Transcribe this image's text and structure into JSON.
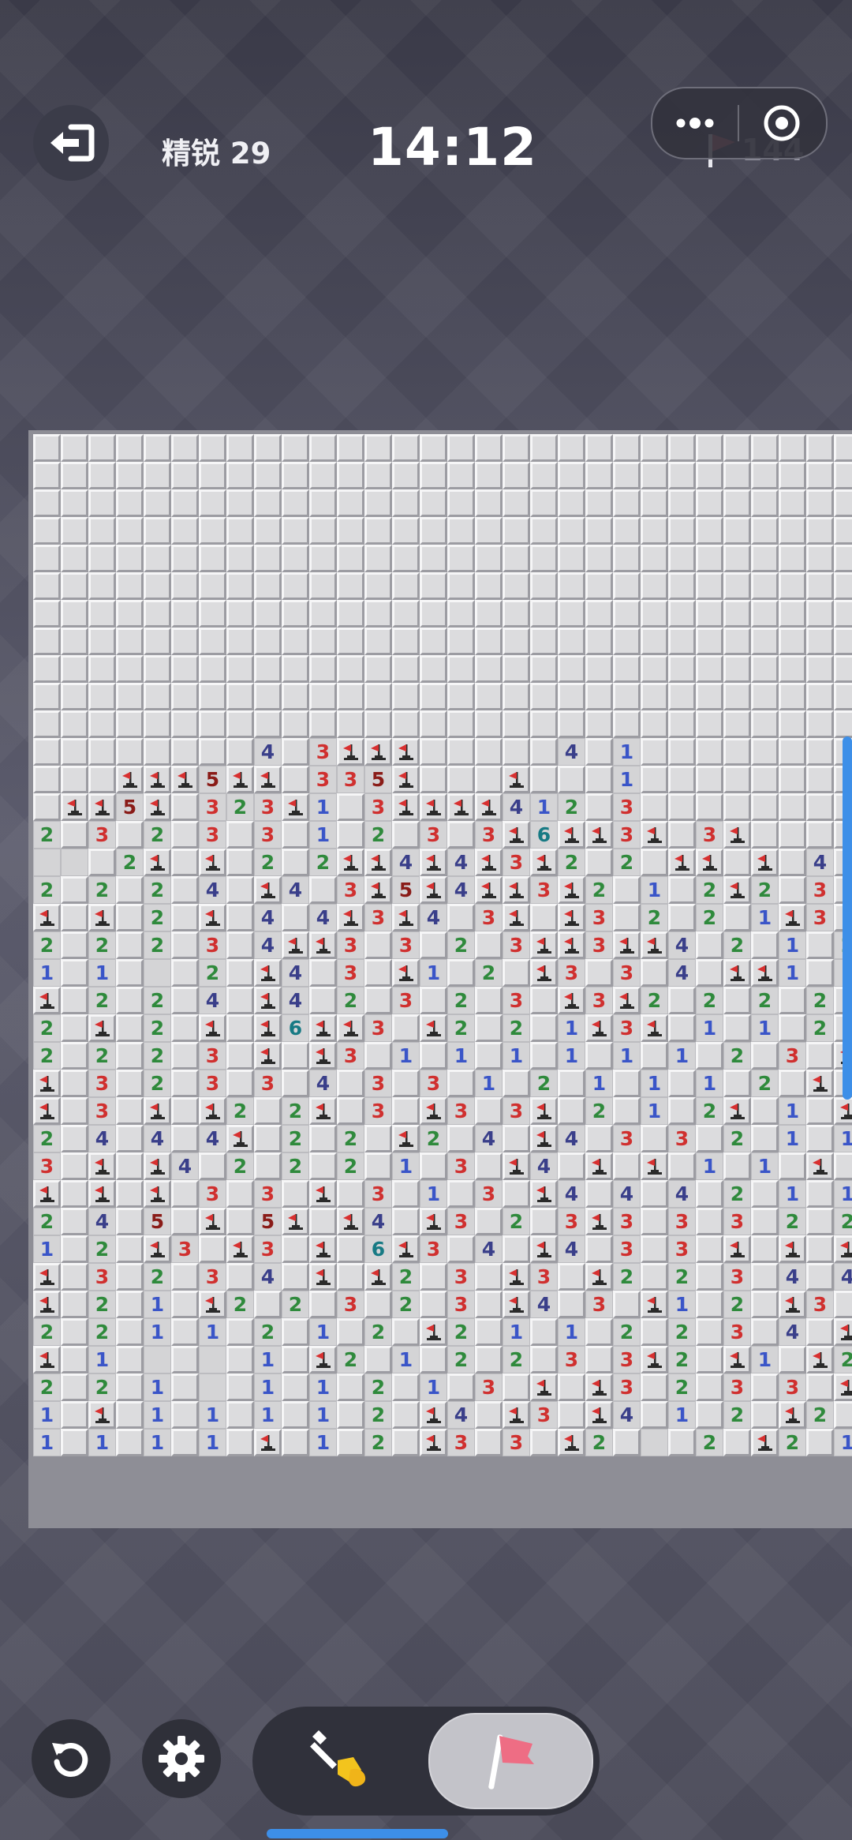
{
  "header": {
    "exit_icon": "exit-icon",
    "level_label": "精锐 29",
    "timer": "14:12",
    "flags_remaining": "144",
    "menu_icon": "more-dots-icon",
    "target_icon": "target-icon"
  },
  "colors": {
    "number_1": "#3a55c8",
    "number_2": "#2f8a3c",
    "number_3": "#d0302f",
    "number_4": "#3a3f8a",
    "number_5": "#8a1c18",
    "number_6": "#177a84",
    "flag": "#d83030",
    "accent_blue": "#3d8fe8"
  },
  "board": {
    "legend": "# hidden, . opened-empty, F flag, 1-6 numbers",
    "rows": [
      "##############################",
      "##############################",
      "##############################",
      "##############################",
      "##############################",
      "##############################",
      "##############################",
      "##############################",
      "##############################",
      "##############################",
      "##############################",
      "########4#3FFF#####4#1########",
      "###FFF5FF#335F###F###1########",
      "#FF5F#323F1#3FFFF412#3########",
      "2#3#2#3#3#1#2#3#3F6FF3F#3F####",
      "..#2F#F#2#2FF4F4F3F2#2#FF#F#4#",
      "2#2#2#4#F4#3F5F4FF3F2#1#2F2#3#",
      "F#F#2#F#4#4F3F4#3F#F3#2#2#1F3#",
      "2#2#2#3#4FF3#3#2#3FF3FF4#2#1#2",
      "1#1#.#2#F4#3#F1#2#F3#3#4#FF1#1",
      "F#2#2#4#F4#2#3#2#3#F3F2#2#2#2#",
      "2#F#2#F#F6FF3#F2#2#1F3F#1#1#2#",
      "2#2#2#3#F#F3#1#1#1#1#1#1#2#3#F",
      "F#3#2#3#3#4#3#3#1#2#1#1#1#2#F#",
      "F#3#F#F2#2F#3#F3#3F#2#1#2F#1#F",
      "2#4#4#4F#2#2#F2#4#F4#3#3#2#1#1",
      "3#F#F4#2#2#2#1#3#F4#F#F#1#1#F#",
      "F#F#F#3#3#F#3#1#3#F4#4#4#2#1#1",
      "2#4#5#F#5F#F4#F3#2#3F3#3#3#2#2",
      "1#2#F3#F3#F#6F3#4#F4#3#3#F#F#F",
      "F#3#2#3#4#F#F2#3#F3#F2#2#3#4#4",
      "F#2#1#F2#2#3#2#3#F4#3#F1#2#F3#",
      "2#2#1#1#2#1#2#F2#1#1#2#2#3#4#F",
      "F#1#.#.#1#F2#1#2#2#3#3F2#F1#F2",
      "2#2#1#.#1#1#2#1#3#F#F3#2#3#3#F",
      "1#F#1#1#1#1#2#F4#F3#F4#1#2#F2#",
      "1#1#1#1#F#1#2#F3#3#F2#.#2#F2#1"
    ]
  }
}
